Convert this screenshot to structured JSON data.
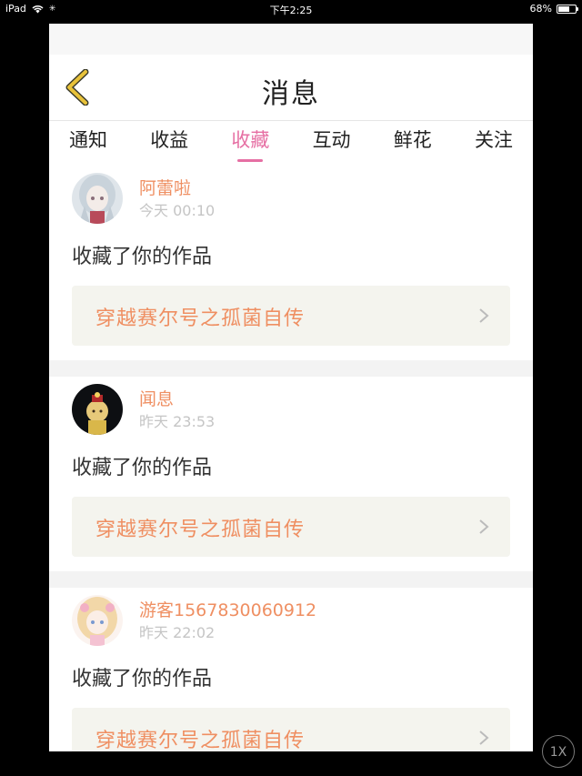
{
  "status_bar": {
    "device": "iPad",
    "time": "下午2:25",
    "battery": "68%",
    "battery_level": 0.68
  },
  "header": {
    "title": "消息"
  },
  "tabs": [
    {
      "label": "通知",
      "active": false
    },
    {
      "label": "收益",
      "active": false
    },
    {
      "label": "收藏",
      "active": true
    },
    {
      "label": "互动",
      "active": false
    },
    {
      "label": "鲜花",
      "active": false
    },
    {
      "label": "关注",
      "active": false
    }
  ],
  "notifications": [
    {
      "user": "阿蕾啦",
      "time": "今天 00:10",
      "action": "收藏了你的作品",
      "work": "穿越赛尔号之孤菌自传",
      "avatar_icon": "anime-girl-avatar-icon"
    },
    {
      "user": "闻息",
      "time": "昨天 23:53",
      "action": "收藏了你的作品",
      "work": "穿越赛尔号之孤菌自传",
      "avatar_icon": "dark-character-avatar-icon"
    },
    {
      "user": "游客1567830060912",
      "time": "昨天 22:02",
      "action": "收藏了你的作品",
      "work": "穿越赛尔号之孤菌自传",
      "avatar_icon": "pink-hair-avatar-icon"
    }
  ],
  "zoom_badge": "1X",
  "colors": {
    "accent": "#e66fa3",
    "username": "#ef8f62",
    "back_arrow": "#e8c23a"
  }
}
